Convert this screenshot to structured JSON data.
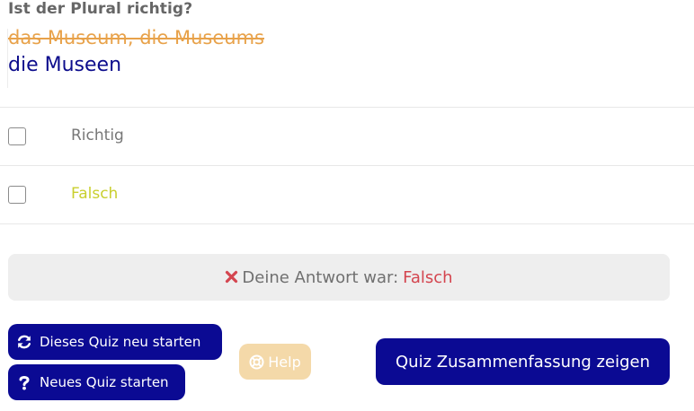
{
  "question": {
    "title": "Ist der Plural richtig?",
    "given_plural": "das Museum, die Museums",
    "correct_plural": "die Museen"
  },
  "options": [
    {
      "label": "Richtig",
      "checked": false,
      "color": "#777777"
    },
    {
      "label": "Falsch",
      "checked": false,
      "color": "#c9cf2e"
    }
  ],
  "feedback": {
    "prefix": "Deine Antwort war:",
    "answer": "Falsch",
    "icon": "x-icon",
    "icon_color": "#d4454f"
  },
  "buttons": {
    "restart_quiz": "Dieses Quiz neu starten",
    "new_quiz": "Neues Quiz starten",
    "help": "Help",
    "summary": "Quiz Zusammenfassung zeigen"
  },
  "colors": {
    "primary": "#0b0a93",
    "help_disabled": "#f4d9a9",
    "strikethrough": "#e8a24a",
    "correct": "#0c0c8c"
  }
}
